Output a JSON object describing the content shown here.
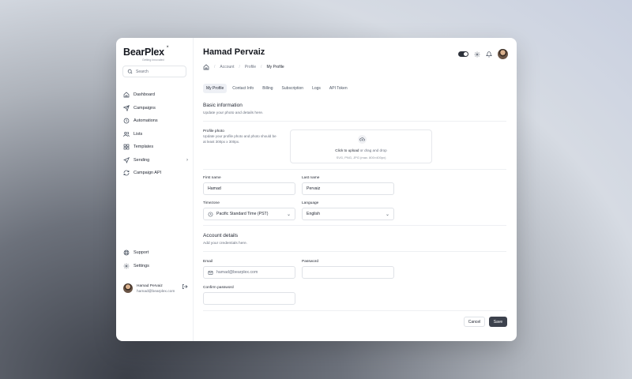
{
  "brand": {
    "name": "BearPlex",
    "tagline": "Getting Innovated"
  },
  "search": {
    "placeholder": "Search"
  },
  "sidebar": {
    "items": [
      {
        "label": "Dashboard",
        "icon": "home-icon"
      },
      {
        "label": "Campaigns",
        "icon": "send-icon"
      },
      {
        "label": "Automations",
        "icon": "clock-icon"
      },
      {
        "label": "Lists",
        "icon": "users-icon"
      },
      {
        "label": "Templates",
        "icon": "grid-icon"
      },
      {
        "label": "Sending",
        "icon": "navigation-icon"
      },
      {
        "label": "Campaign API",
        "icon": "refresh-icon"
      }
    ],
    "bottom": [
      {
        "label": "Support",
        "icon": "lifebuoy-icon"
      },
      {
        "label": "Settings",
        "icon": "gear-icon"
      }
    ],
    "user": {
      "name": "Hamad Pervaiz",
      "email": "hamad@bearplex.com"
    }
  },
  "header": {
    "title": "Hamad Pervaiz"
  },
  "breadcrumb": [
    "Account",
    "Profile",
    "My Profile"
  ],
  "tabs": [
    "My Profile",
    "Contact Info",
    "Billing",
    "Subscription",
    "Logs",
    "API Token"
  ],
  "basic": {
    "title": "Basic information",
    "subtitle": "Update your photo and details here.",
    "photo_label": "Profile photo",
    "photo_help": "Update your profile photo and photo should be at least 300px x 300px.",
    "upload_link": "Click to upload",
    "upload_rest": " or drag and drop",
    "upload_formats": "SVG, PNG, JPG (max. 800×400px)",
    "first_name_label": "First name",
    "first_name_value": "Hamad",
    "last_name_label": "Last name",
    "last_name_value": "Pervaiz",
    "timezone_label": "Timezone",
    "timezone_value": "Pacific Standard Time (PST)",
    "language_label": "Language",
    "language_value": "English"
  },
  "account": {
    "title": "Account details",
    "subtitle": "Add your credentials here.",
    "email_label": "Email",
    "email_placeholder": "hamad@bearplex.com",
    "password_label": "Password",
    "confirm_label": "Confirm password"
  },
  "actions": {
    "cancel": "Cancel",
    "save": "Save"
  },
  "colors": {
    "primary_button": "#3d424d",
    "active_tab_bg": "#eef0f5"
  }
}
